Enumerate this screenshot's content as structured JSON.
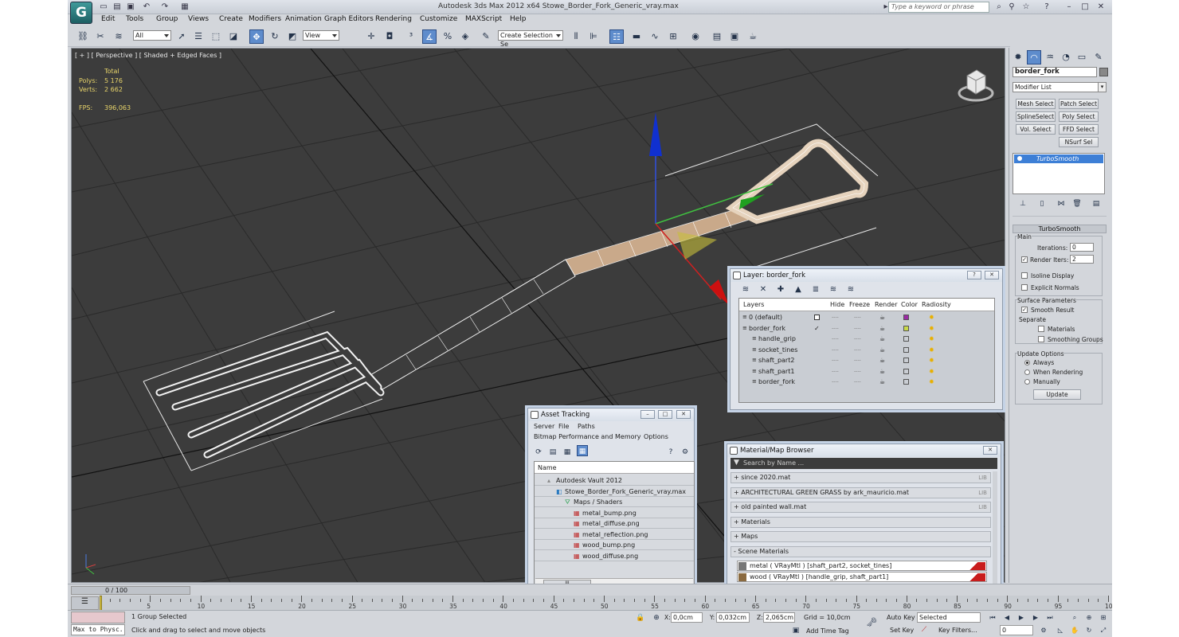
{
  "app": {
    "logo": "G",
    "title": "Autodesk 3ds Max  2012 x64      Stowe_Border_Fork_Generic_vray.max",
    "search_placeholder": "Type a keyword or phrase"
  },
  "menu": [
    "Edit",
    "Tools",
    "Group",
    "Views",
    "Create",
    "Modifiers",
    "Animation",
    "Graph Editors",
    "Rendering",
    "Customize",
    "MAXScript",
    "Help"
  ],
  "toolbar": {
    "filter": "All",
    "refcoord": "View",
    "selection_set": "Create Selection Se"
  },
  "viewport": {
    "label": "[ + ] [ Perspective ] [ Shaded + Edged Faces ]",
    "stats": {
      "total_label": "Total",
      "polys_label": "Polys:",
      "polys": "5 176",
      "verts_label": "Verts:",
      "verts": "2 662",
      "fps_label": "FPS:",
      "fps": "396,063"
    },
    "background": "#3c3c3c",
    "grid_color": "#2a2a2a"
  },
  "command_panel": {
    "object_name": "border_fork",
    "modifier_list": "Modifier List",
    "modifier_buttons": [
      "Mesh Select",
      "Patch Select",
      "SplineSelect",
      "Poly Select",
      "Vol. Select",
      "FFD Select",
      "",
      "NSurf Sel"
    ],
    "stack_item": "TurboSmooth",
    "rollout_title": "TurboSmooth",
    "main_label": "Main",
    "iterations_label": "Iterations:",
    "iterations": "0",
    "render_iters_label": "Render Iters:",
    "render_iters": "2",
    "render_iters_checked": "✓",
    "isoline_label": "Isoline Display",
    "explicit_label": "Explicit Normals",
    "surface_label": "Surface Parameters",
    "smooth_result_label": "Smooth Result",
    "smooth_checked": "✓",
    "separate_label": "Separate",
    "materials_label": "Materials",
    "smoothing_groups_label": "Smoothing Groups",
    "update_options_label": "Update Options",
    "always_label": "Always",
    "when_rendering_label": "When Rendering",
    "manually_label": "Manually",
    "update_button": "Update"
  },
  "layer_window": {
    "title": "Layer: border_fork",
    "help_button": "?",
    "close_button": "✕",
    "columns": [
      "Layers",
      "Hide",
      "Freeze",
      "Render",
      "Color",
      "Radiosity"
    ],
    "rows": [
      {
        "name": "0 (default)",
        "mark": "",
        "color": "#9b2aa5"
      },
      {
        "name": "border_fork",
        "mark": "✓",
        "color": "#c8d84a"
      },
      {
        "name": "handle_grip",
        "mark": "",
        "color": ""
      },
      {
        "name": "socket_tines",
        "mark": "",
        "color": ""
      },
      {
        "name": "shaft_part2",
        "mark": "",
        "color": ""
      },
      {
        "name": "shaft_part1",
        "mark": "",
        "color": ""
      },
      {
        "name": "border_fork",
        "mark": "",
        "color": ""
      }
    ],
    "dashes": "----"
  },
  "asset_window": {
    "title": "Asset Tracking",
    "menu": [
      "Server",
      "File",
      "Paths"
    ],
    "menu2": [
      "Bitmap Performance and Memory",
      "Options"
    ],
    "header": "Name",
    "items": [
      {
        "label": "Autodesk Vault 2012",
        "indent": 0
      },
      {
        "label": "Stowe_Border_Fork_Generic_vray.max",
        "indent": 1
      },
      {
        "label": "Maps / Shaders",
        "indent": 2
      },
      {
        "label": "metal_bump.png",
        "indent": 3
      },
      {
        "label": "metal_diffuse.png",
        "indent": 3
      },
      {
        "label": "metal_reflection.png",
        "indent": 3
      },
      {
        "label": "wood_bump.png",
        "indent": 3
      },
      {
        "label": "wood_diffuse.png",
        "indent": 3
      }
    ],
    "scroll_grip": "III"
  },
  "material_window": {
    "title": "Material/Map Browser",
    "search_placeholder": "Search by Name ...",
    "groups": [
      {
        "label": "+ since 2020.mat",
        "tag": "LIB"
      },
      {
        "label": "+ ARCHITECTURAL GREEN GRASS by ark_mauricio.mat",
        "tag": "LIB"
      },
      {
        "label": "+ old painted wall.mat",
        "tag": "LIB"
      },
      {
        "label": "+ Materials",
        "tag": ""
      },
      {
        "label": "+ Maps",
        "tag": ""
      },
      {
        "label": "- Scene Materials",
        "tag": ""
      }
    ],
    "scene_materials": [
      "metal  ( VRayMtl ) [shaft_part2, socket_tines]",
      "wood  ( VRayMtl ) [handle_grip, shaft_part1]"
    ]
  },
  "timeline": {
    "frame": "0 / 100",
    "ticks": [
      "0",
      "5",
      "10",
      "15",
      "20",
      "25",
      "30",
      "35",
      "40",
      "45",
      "50",
      "55",
      "60",
      "65",
      "70",
      "75",
      "80",
      "85",
      "90",
      "95",
      "100"
    ]
  },
  "status": {
    "listener": "Max to Physc.",
    "selected": "1 Group Selected",
    "prompt": "Click and drag to select and move objects",
    "x_label": "X:",
    "x": "0,0cm",
    "y_label": "Y:",
    "y": "0,032cm",
    "z_label": "Z:",
    "z": "2,065cm",
    "grid": "Grid = 10,0cm",
    "add_time_tag": "Add Time Tag",
    "auto_key": "Auto Key",
    "set_key": "Set Key",
    "key_mode": "Selected",
    "key_filters": "Key Filters...",
    "frame_field": "0"
  }
}
